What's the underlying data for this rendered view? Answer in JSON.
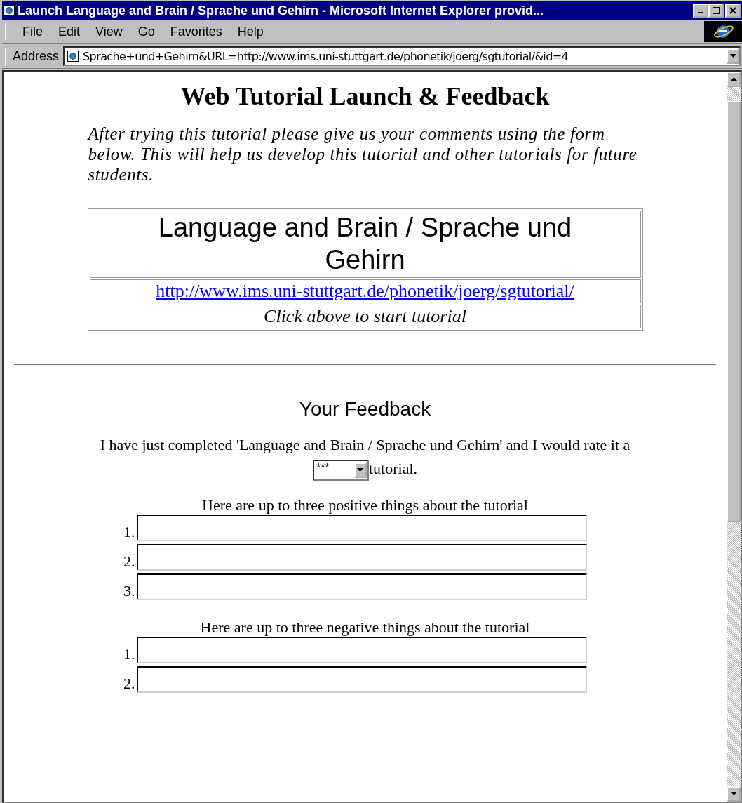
{
  "window": {
    "title": "Launch Language and Brain / Sprache und Gehirn - Microsoft Internet Explorer provid..."
  },
  "menu": [
    {
      "label": "File"
    },
    {
      "label": "Edit"
    },
    {
      "label": "View"
    },
    {
      "label": "Go"
    },
    {
      "label": "Favorites"
    },
    {
      "label": "Help"
    }
  ],
  "address": {
    "label": "Address",
    "value": "Sprache+und+Gehirn&URL=http://www.ims.uni-stuttgart.de/phonetik/joerg/sgtutorial/&id=4"
  },
  "page": {
    "heading": "Web Tutorial Launch & Feedback",
    "intro": "After trying this tutorial please give us your comments using the form below. This will help us develop this tutorial and other tutorials for future students.",
    "tutorial_table": {
      "title": "Language and Brain / Sprache und Gehirn",
      "link": "http://www.ims.uni-stuttgart.de/phonetik/joerg/sgtutorial/",
      "hint": "Click above to start tutorial"
    },
    "feedback_heading": "Your Feedback",
    "rating_before": "I have just completed 'Language and Brain / Sprache und Gehirn' and I would rate it a",
    "rating_value": "***",
    "rating_after": "tutorial.",
    "groups": [
      {
        "label": "Here are up to three positive things about the tutorial",
        "items": [
          {
            "number": "1."
          },
          {
            "number": "2."
          },
          {
            "number": "3."
          }
        ]
      },
      {
        "label": "Here are up to three negative things about the tutorial",
        "items": [
          {
            "number": "1."
          },
          {
            "number": "2."
          }
        ]
      }
    ]
  }
}
